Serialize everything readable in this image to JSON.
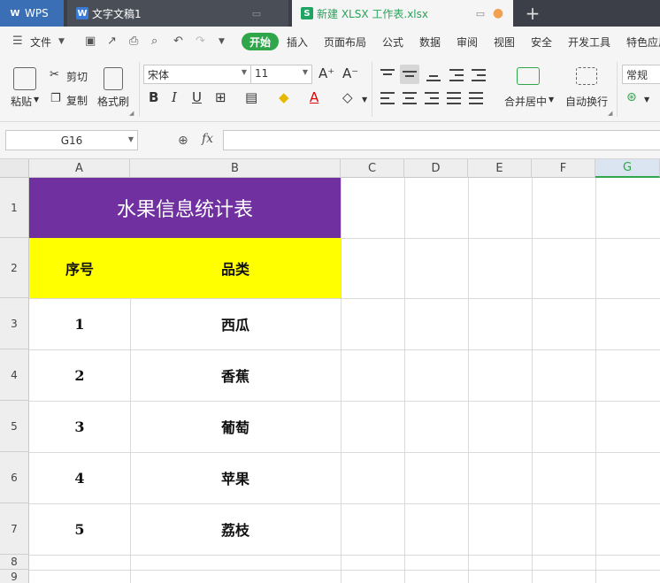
{
  "titlebar": {
    "tabs": [
      {
        "label": "WPS",
        "icon": "wps-logo-icon"
      },
      {
        "label": "文字文稿1",
        "icon": "word-doc-icon"
      },
      {
        "label": "新建 XLSX 工作表.xlsx",
        "icon": "spreadsheet-icon",
        "active": true
      }
    ],
    "new_tab": "+"
  },
  "menubar": {
    "file": "文件",
    "items": [
      "开始",
      "插入",
      "页面布局",
      "公式",
      "数据",
      "审阅",
      "视图",
      "安全",
      "开发工具",
      "特色应用"
    ],
    "active": "开始"
  },
  "ribbon": {
    "paste": "粘贴",
    "cut": "剪切",
    "copy": "复制",
    "format_painter": "格式刷",
    "font_name": "宋体",
    "font_size": "11",
    "merge_center": "合并居中",
    "wrap_text": "自动换行",
    "number_format": "常规"
  },
  "formula_bar": {
    "name_box": "G16",
    "fx": "fx",
    "value": ""
  },
  "grid": {
    "columns": [
      "A",
      "B",
      "C",
      "D",
      "E",
      "F",
      "G"
    ],
    "selected_column": "G",
    "rows": [
      "1",
      "2",
      "3",
      "4",
      "5",
      "6",
      "7",
      "8",
      "9"
    ]
  },
  "table": {
    "title": "水果信息统计表",
    "headers": [
      "序号",
      "品类"
    ],
    "rows": [
      [
        "1",
        "西瓜"
      ],
      [
        "2",
        "香蕉"
      ],
      [
        "3",
        "葡萄"
      ],
      [
        "4",
        "苹果"
      ],
      [
        "5",
        "荔枝"
      ]
    ]
  },
  "colors": {
    "title_bg": "#7030a0",
    "header_bg": "#ffff00",
    "accent": "#2fa64a"
  }
}
